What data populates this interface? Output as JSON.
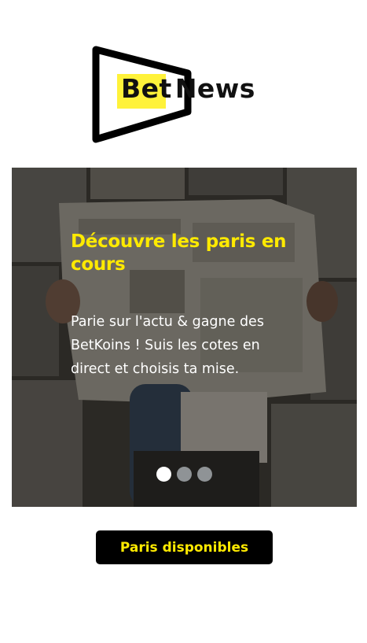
{
  "logo": {
    "part1": "Bet",
    "part2": "News",
    "icon": "tv-frame-icon",
    "accent_color": "#fff23a"
  },
  "carousel": {
    "title": "Découvre les paris en cours",
    "text": "Parie sur l'actu & gagne des BetKoins ! Suis les cotes en direct et choisis ta mise.",
    "background": "newspaper-reading-photo",
    "slide_count": 3,
    "active_index": 0,
    "colors": {
      "title": "#ffea00",
      "text": "#ffffff"
    }
  },
  "cta": {
    "label": "Paris disponibles",
    "background": "#000000",
    "color": "#ffea00"
  }
}
